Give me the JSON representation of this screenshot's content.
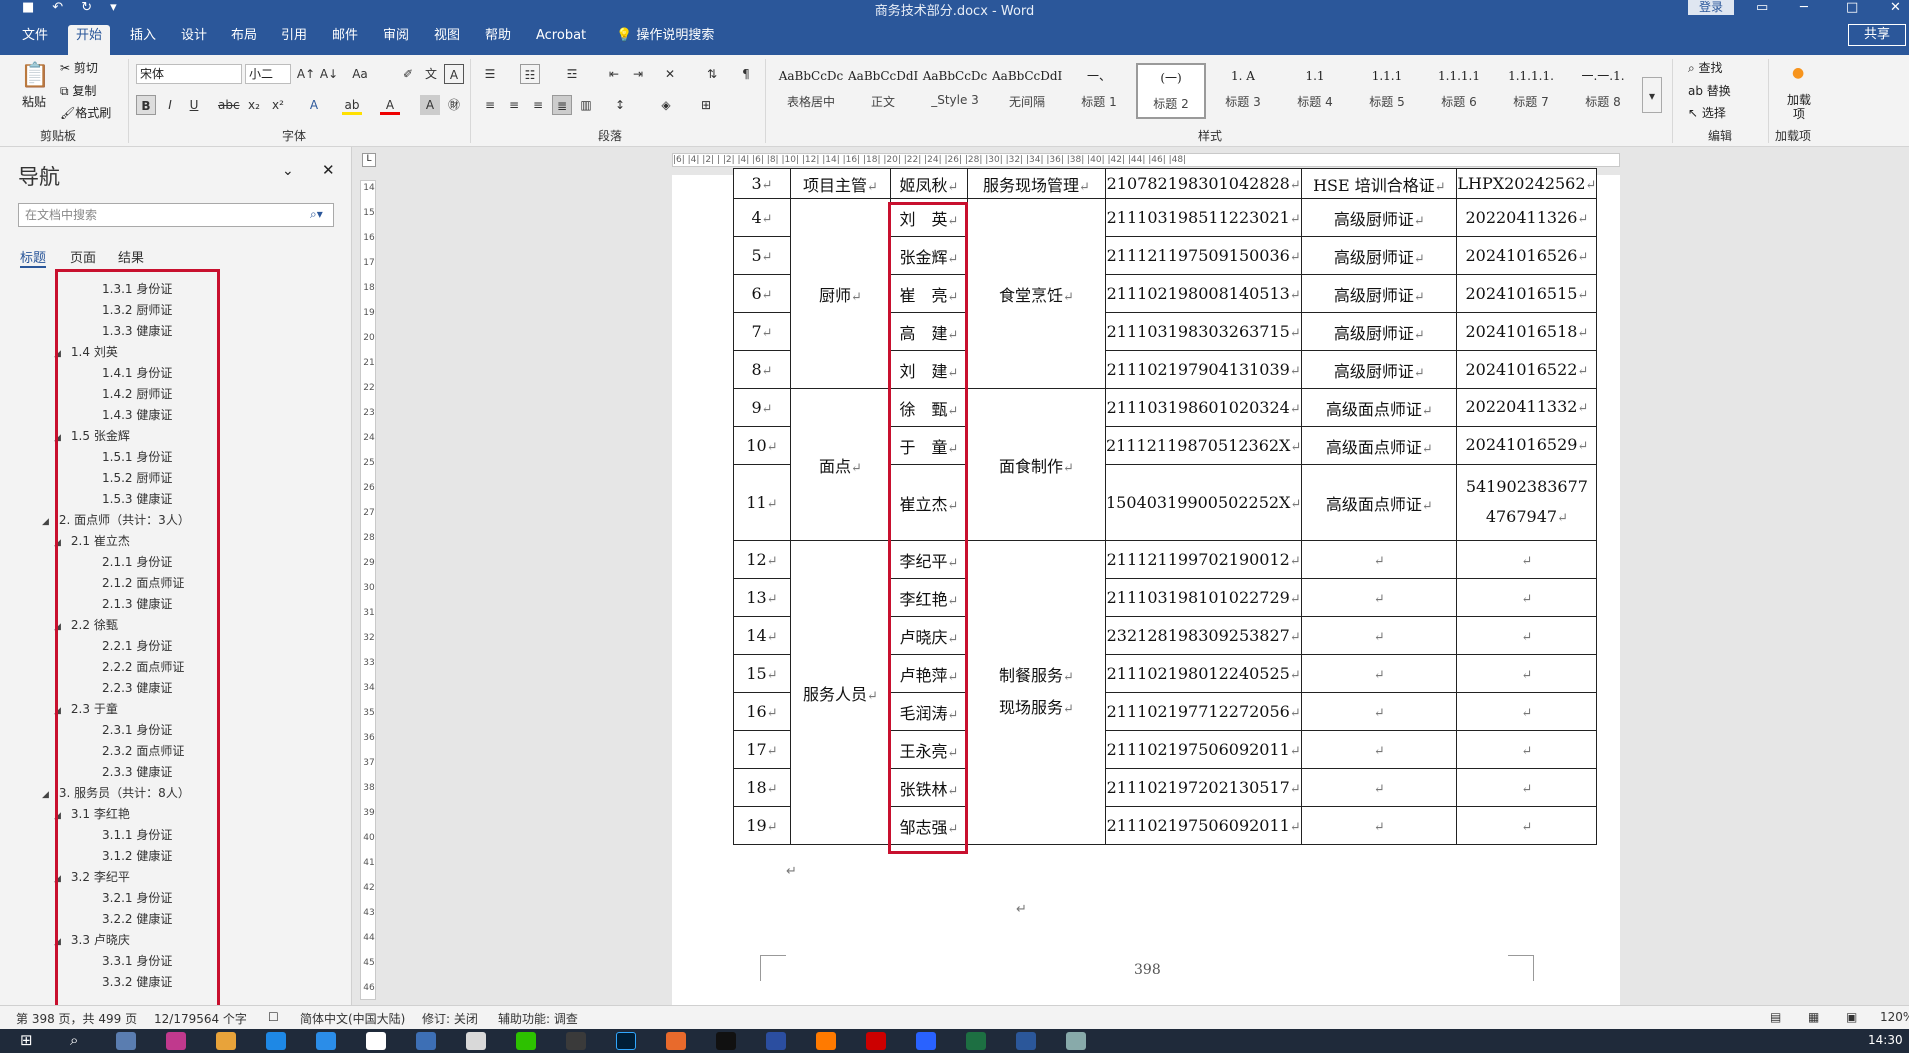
{
  "window": {
    "title": "商务技术部分.docx  -  Word",
    "login": "登录",
    "share": "共享"
  },
  "tabs": [
    "文件",
    "开始",
    "插入",
    "设计",
    "布局",
    "引用",
    "邮件",
    "审阅",
    "视图",
    "帮助",
    "Acrobat",
    "操作说明搜索"
  ],
  "ribbon": {
    "clipboard": {
      "paste": "粘贴",
      "cut": "剪切",
      "copy": "复制",
      "format_painter": "格式刷",
      "label": "剪贴板"
    },
    "font": {
      "name": "宋体",
      "size": "小二",
      "label": "字体"
    },
    "paragraph": {
      "label": "段落"
    },
    "styles": {
      "label": "样式",
      "items": [
        {
          "preview": "AaBbCcDc",
          "name": "表格居中"
        },
        {
          "preview": "AaBbCcDdI",
          "name": "正文"
        },
        {
          "preview": "AaBbCcDc",
          "name": "_Style 3"
        },
        {
          "preview": "AaBbCcDdI",
          "name": "无间隔"
        },
        {
          "preview": "一、",
          "name": "标题 1"
        },
        {
          "preview": "(一)",
          "name": "标题 2"
        },
        {
          "preview": "1.  A",
          "name": "标题 3"
        },
        {
          "preview": "1.1",
          "name": "标题 4"
        },
        {
          "preview": "1.1.1",
          "name": "标题 5"
        },
        {
          "preview": "1.1.1.1",
          "name": "标题 6"
        },
        {
          "preview": "1.1.1.1.",
          "name": "标题 7"
        },
        {
          "preview": "一.一.1.",
          "name": "标题 8"
        }
      ]
    },
    "editing": {
      "find": "查找",
      "replace": "替换",
      "select": "选择",
      "label": "编辑"
    },
    "addins": {
      "btn": "加载项",
      "label": "加载项"
    }
  },
  "nav": {
    "title": "导航",
    "search_placeholder": "在文档中搜索",
    "tabs": [
      "标题",
      "页面",
      "结果"
    ],
    "items": [
      {
        "t": "1.3.1 身份证",
        "lv": 3
      },
      {
        "t": "1.3.2 厨师证",
        "lv": 3
      },
      {
        "t": "1.3.3 健康证",
        "lv": 3
      },
      {
        "t": "1.4 刘英",
        "lv": 2
      },
      {
        "t": "1.4.1 身份证",
        "lv": 3
      },
      {
        "t": "1.4.2 厨师证",
        "lv": 3
      },
      {
        "t": "1.4.3 健康证",
        "lv": 3
      },
      {
        "t": "1.5 张金辉",
        "lv": 2
      },
      {
        "t": "1.5.1 身份证",
        "lv": 3
      },
      {
        "t": "1.5.2 厨师证",
        "lv": 3
      },
      {
        "t": "1.5.3 健康证",
        "lv": 3
      },
      {
        "t": "2. 面点师（共计：3人）",
        "lv": 1
      },
      {
        "t": "2.1 崔立杰",
        "lv": 2
      },
      {
        "t": "2.1.1 身份证",
        "lv": 3
      },
      {
        "t": "2.1.2 面点师证",
        "lv": 3
      },
      {
        "t": "2.1.3 健康证",
        "lv": 3
      },
      {
        "t": "2.2 徐甄",
        "lv": 2
      },
      {
        "t": "2.2.1 身份证",
        "lv": 3
      },
      {
        "t": "2.2.2 面点师证",
        "lv": 3
      },
      {
        "t": "2.2.3 健康证",
        "lv": 3
      },
      {
        "t": "2.3 于童",
        "lv": 2
      },
      {
        "t": "2.3.1 身份证",
        "lv": 3
      },
      {
        "t": "2.3.2 面点师证",
        "lv": 3
      },
      {
        "t": "2.3.3 健康证",
        "lv": 3
      },
      {
        "t": "3. 服务员（共计：8人）",
        "lv": 1
      },
      {
        "t": "3.1 李红艳",
        "lv": 2
      },
      {
        "t": "3.1.1 身份证",
        "lv": 3
      },
      {
        "t": "3.1.2 健康证",
        "lv": 3
      },
      {
        "t": "3.2 李纪平",
        "lv": 2
      },
      {
        "t": "3.2.1 身份证",
        "lv": 3
      },
      {
        "t": "3.2.2 健康证",
        "lv": 3
      },
      {
        "t": "3.3 卢晓庆",
        "lv": 2
      },
      {
        "t": "3.3.1 身份证",
        "lv": 3
      },
      {
        "t": "3.3.2 健康证",
        "lv": 3
      }
    ]
  },
  "ruler": {
    "top": "|6|  |4|  |2|  |  |2|  |4|  |6|  |8|  |10|  |12|  |14|  |16|  |18|  |20|  |22|  |24|  |26|  |28|  |30|  |32|  |34|  |36|  |38|  |40|  |42|  |44|  |46|  |48|",
    "left": [
      "14",
      "15",
      "16",
      "17",
      "18",
      "19",
      "20",
      "21",
      "22",
      "23",
      "24",
      "25",
      "26",
      "27",
      "28",
      "29",
      "30",
      "31",
      "32",
      "33",
      "34",
      "35",
      "36",
      "37",
      "38",
      "39",
      "40",
      "41",
      "42",
      "43",
      "44",
      "45",
      "46"
    ]
  },
  "table": {
    "mark": "↵",
    "row3": {
      "no": "3",
      "role": "项目主管",
      "name": "姬凤秋",
      "duty": "服务现场管理",
      "id": "210782198301042828",
      "cert": "HSE 培训合格证",
      "certno": "LHPX20242562"
    },
    "chef": {
      "role": "厨师",
      "duty": "食堂烹饪",
      "rows": [
        {
          "no": "4",
          "name": "刘　英",
          "id": "211103198511223021",
          "cert": "高级厨师证",
          "certno": "20220411326"
        },
        {
          "no": "5",
          "name": "张金辉",
          "id": "211121197509150036",
          "cert": "高级厨师证",
          "certno": "20241016526"
        },
        {
          "no": "6",
          "name": "崔　亮",
          "id": "211102198008140513",
          "cert": "高级厨师证",
          "certno": "20241016515"
        },
        {
          "no": "7",
          "name": "高　建",
          "id": "211103198303263715",
          "cert": "高级厨师证",
          "certno": "20241016518"
        },
        {
          "no": "8",
          "name": "刘　建",
          "id": "211102197904131039",
          "cert": "高级厨师证",
          "certno": "20241016522"
        }
      ]
    },
    "pastry": {
      "role": "面点",
      "duty": "面食制作",
      "rows": [
        {
          "no": "9",
          "name": "徐　甄",
          "id": "211103198601020324",
          "cert": "高级面点师证",
          "certno": "20220411332"
        },
        {
          "no": "10",
          "name": "于　童",
          "id": "21112119870512362X",
          "cert": "高级面点师证",
          "certno": "20241016529"
        },
        {
          "no": "11",
          "name": "崔立杰",
          "id": "15040319900502252X",
          "cert": "高级面点师证",
          "certno": "541902383677 4767947"
        }
      ]
    },
    "service": {
      "role": "服务人员",
      "duty1": "制餐服务",
      "duty2": "现场服务",
      "rows": [
        {
          "no": "12",
          "name": "李纪平",
          "id": "211121199702190012"
        },
        {
          "no": "13",
          "name": "李红艳",
          "id": "211103198101022729"
        },
        {
          "no": "14",
          "name": "卢晓庆",
          "id": "232128198309253827"
        },
        {
          "no": "15",
          "name": "卢艳萍",
          "id": "211102198012240525"
        },
        {
          "no": "16",
          "name": "毛润涛",
          "id": "211102197712272056"
        },
        {
          "no": "17",
          "name": "王永亮",
          "id": "211102197506092011"
        },
        {
          "no": "18",
          "name": "张铁林",
          "id": "211102197202130517"
        },
        {
          "no": "19",
          "name": "邹志强",
          "id": "211102197506092011"
        }
      ]
    }
  },
  "page_number": "398",
  "status": {
    "page": "第 398 页，共 499 页",
    "words": "12/179564 个字",
    "lang": "简体中文(中国大陆)",
    "track": "修订: 关闭",
    "access": "辅助功能: 调查",
    "zoom": "120%"
  },
  "clock": "14:30",
  "colors": {
    "accent": "#2b579a",
    "highlight_box": "#c8102e"
  }
}
